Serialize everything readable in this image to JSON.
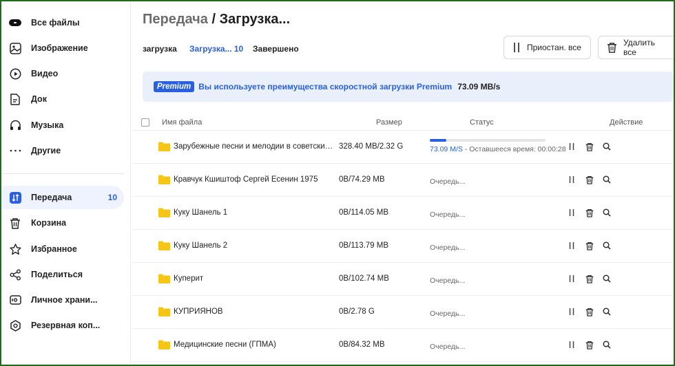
{
  "sidebar": {
    "items": [
      {
        "label": "Все файлы",
        "icon": "all-files-icon"
      },
      {
        "label": "Изображение",
        "icon": "image-icon"
      },
      {
        "label": "Видео",
        "icon": "video-icon"
      },
      {
        "label": "Док",
        "icon": "document-icon"
      },
      {
        "label": "Музыка",
        "icon": "headphones-icon"
      },
      {
        "label": "Другие",
        "icon": "more-dots-icon"
      },
      {
        "label": "Передача",
        "icon": "transfer-icon",
        "badge": "10",
        "active": true
      },
      {
        "label": "Корзина",
        "icon": "trash-icon"
      },
      {
        "label": "Избранное",
        "icon": "star-icon"
      },
      {
        "label": "Поделиться",
        "icon": "share-icon"
      },
      {
        "label": "Личное храни...",
        "icon": "private-vault-icon"
      },
      {
        "label": "Резервная коп...",
        "icon": "backup-icon"
      }
    ]
  },
  "header": {
    "crumb": "Передача",
    "separator": "/",
    "current": "Загрузка..."
  },
  "tabs": [
    {
      "label": "загрузка",
      "active": false
    },
    {
      "label": "Загрузка... 10",
      "active": true
    },
    {
      "label": "Завершено",
      "active": false
    }
  ],
  "toolbar": {
    "pause_all_label": "Приостан. все",
    "delete_all_label": "Удалить все"
  },
  "banner": {
    "badge": "Premium",
    "message": "Вы используете преимущества скоростной загрузки Premium",
    "speed": "73.09 MB/s"
  },
  "table": {
    "headers": {
      "name": "Имя файла",
      "size": "Размер",
      "status": "Статус",
      "action": "Действие"
    },
    "rows": [
      {
        "name": "Зарубежные песни и мелодии в советских ф...",
        "size": "328.40 MB/2.32 G",
        "progress": 0.14,
        "speed": "73.09 M/S",
        "remaining": " - Оставшееся время: 00:00:28"
      },
      {
        "name": "Кравчук Кшиштоф Сергей Есенин 1975",
        "size": "0B/74.29 MB",
        "status": "Очередь..."
      },
      {
        "name": "Куку Шанель 1",
        "size": "0B/114.05 MB",
        "status": "Очередь..."
      },
      {
        "name": "Куку Шанель 2",
        "size": "0B/113.79 MB",
        "status": "Очередь..."
      },
      {
        "name": "Куперит",
        "size": "0B/102.74 MB",
        "status": "Очередь..."
      },
      {
        "name": "КУПРИЯНОВ",
        "size": "0B/2.78 G",
        "status": "Очередь..."
      },
      {
        "name": "Медицинские песни (ГПМА)",
        "size": "0B/84.32 MB",
        "status": "Очередь..."
      }
    ]
  },
  "colors": {
    "accent": "#2a60df",
    "folder": "#f5c518",
    "sidebar_active": "#eef3ff",
    "banner_bg": "#eaf0fb"
  }
}
